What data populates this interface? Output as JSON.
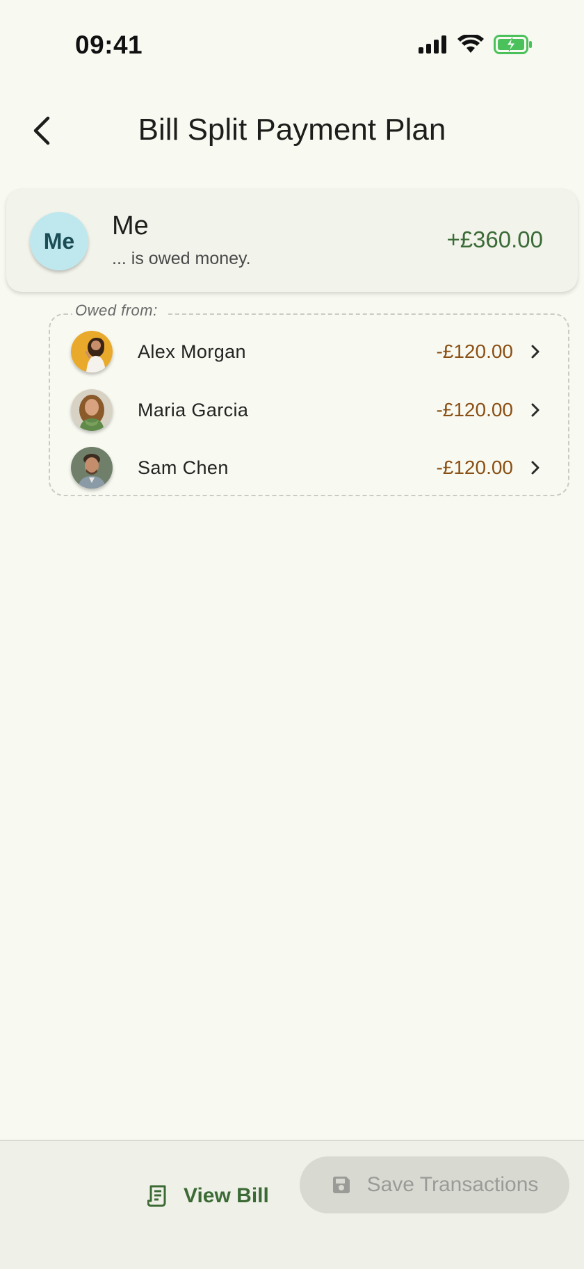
{
  "status_bar": {
    "time": "09:41"
  },
  "header": {
    "title": "Bill Split Payment Plan",
    "back_icon": "chevron-left-icon"
  },
  "creditor": {
    "avatar_text": "Me",
    "name": "Me",
    "subtitle": "... is owed money.",
    "amount": "+£360.00",
    "amount_color": "#3a6b36",
    "avatar_color": "#bfe8ee"
  },
  "owed_from": {
    "label": "Owed from:",
    "debtors": [
      {
        "name": "Alex Morgan",
        "amount": "-£120.00",
        "avatar": "person-photo"
      },
      {
        "name": "Maria Garcia",
        "amount": "-£120.00",
        "avatar": "person-photo"
      },
      {
        "name": "Sam Chen",
        "amount": "-£120.00",
        "avatar": "person-photo"
      }
    ],
    "amount_color": "#8a4f14"
  },
  "bottom_bar": {
    "view_bill_label": "View Bill",
    "view_bill_icon": "receipt-icon",
    "save_label": "Save Transactions",
    "save_icon": "floppy-disk-icon",
    "save_disabled": true
  },
  "colors": {
    "background": "#f8faf2",
    "accent_green": "#3c6a35"
  }
}
